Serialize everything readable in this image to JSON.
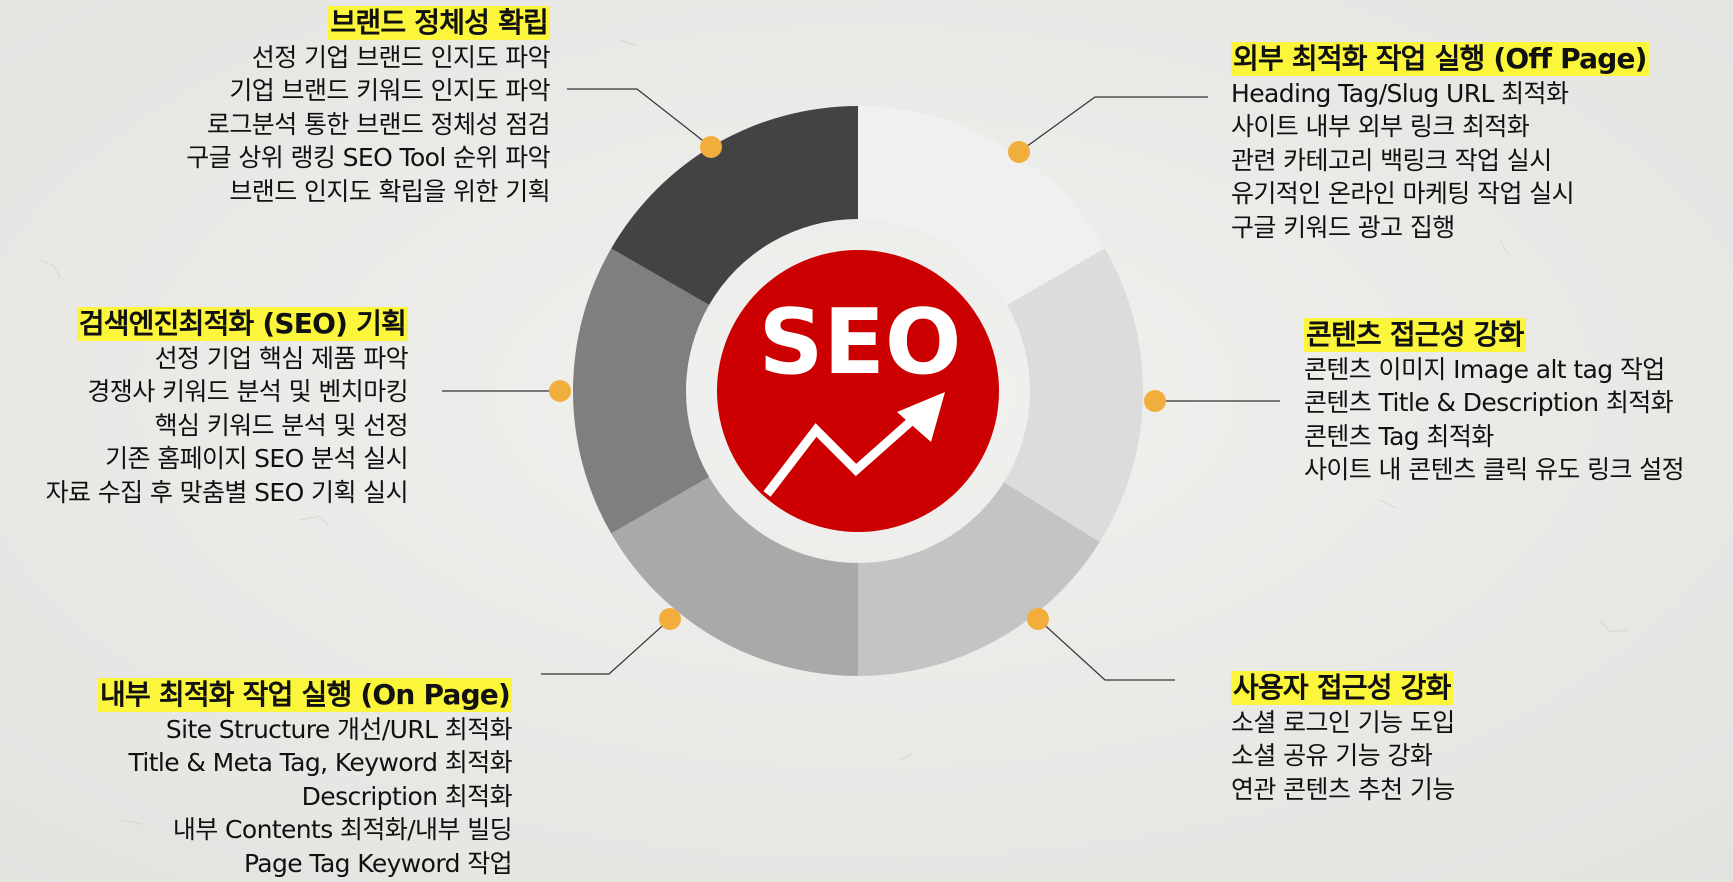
{
  "center": {
    "label": "SEO"
  },
  "colors": {
    "highlight": "#fbf53b",
    "center_circle": "#cc0000",
    "dot": "#f2ae3c",
    "segments": [
      "#434343",
      "#f0f0f0",
      "#dcdcdc",
      "#c4c4c4",
      "#a9a9a9",
      "#7f7f7f"
    ]
  },
  "sections": {
    "brand": {
      "title": "브랜드 정체성 확립",
      "items": [
        "선정 기업 브랜드 인지도 파악",
        "기업 브랜드 키워드 인지도 파악",
        "로그분석 통한 브랜드 정체성 점검",
        "구글 상위 랭킹 SEO Tool 순위 파악",
        "브랜드 인지도 확립을 위한 기획"
      ]
    },
    "seo_plan": {
      "title": "검색엔진최적화 (SEO) 기획",
      "items": [
        "선정 기업 핵심 제품 파악",
        "경쟁사 키워드 분석 및 벤치마킹",
        "핵심 키워드 분석 및 선정",
        "기존 홈페이지 SEO 분석 실시",
        "자료 수집 후 맞춤별 SEO  기획 실시"
      ]
    },
    "on_page": {
      "title": "내부 최적화 작업 실행 (On Page)",
      "items": [
        "Site Structure 개선/URL 최적화",
        "Title & Meta Tag, Keyword 최적화",
        "Description 최적화",
        "내부 Contents 최적화/내부 빌딩",
        "Page Tag Keyword 작업"
      ]
    },
    "off_page": {
      "title": "외부 최적화 작업 실행 (Off Page)",
      "items": [
        "Heading Tag/Slug URL 최적화",
        "사이트 내부 외부 링크 최적화",
        "관련 카테고리 백링크 작업 실시",
        "유기적인 온라인 마케팅 작업 실시",
        "구글 키워드 광고 집행"
      ]
    },
    "content": {
      "title": "콘텐츠 접근성 강화",
      "items": [
        "콘텐츠 이미지 Image alt tag 작업",
        "콘텐츠 Title & Description 최적화",
        "콘텐츠 Tag 최적화",
        "사이트 내 콘텐츠 클릭 유도 링크 설정"
      ]
    },
    "user": {
      "title": "사용자 접근성 강화",
      "items": [
        "소셜 로그인 기능 도입",
        "소셜 공유 기능 강화",
        "연관 콘텐츠 추천 기능"
      ]
    }
  }
}
